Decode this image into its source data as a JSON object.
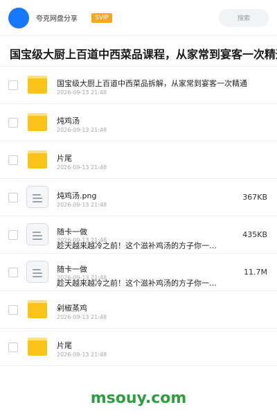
{
  "header": {
    "user_name": "夸克网盘分享",
    "badge": "SVIP",
    "search_placeholder": "搜索",
    "accent": "#1677ff",
    "badge_color": "#f5a623"
  },
  "title": "国宝级大厨上百道中西菜品课程，从家常到宴客一次精通",
  "files": [
    {
      "type": "folder-icon",
      "name": "国宝级大厨上百道中西菜品拆解，从家常到宴客一次精通",
      "date": "2026-09-13 21:48",
      "size": "",
      "desc": ""
    },
    {
      "type": "folder-icon",
      "name": "炖鸡汤",
      "date": "2026-09-13 21:48",
      "size": "",
      "desc": ""
    },
    {
      "type": "folder-icon",
      "name": "片尾",
      "date": "2026-09-13 21:48",
      "size": "",
      "desc": ""
    },
    {
      "type": "document-icon",
      "name": "炖鸡汤.png",
      "date": "2026-09-13 21:48",
      "size": "367KB",
      "desc": ""
    },
    {
      "type": "document-icon",
      "name": "随卡一做",
      "date": "2026-09-13 21:48",
      "size": "435KB",
      "desc": "趁天越来越冷之前！这个滋补鸡汤的方子你一…"
    },
    {
      "type": "document-icon",
      "name": "随卡一做",
      "date": "2026-09-13 21:48",
      "size": "11.7M",
      "desc": "趁天越来越冷之前！这个滋补鸡汤的方子你一…"
    },
    {
      "type": "folder-icon",
      "name": "剁椒蒸鸡",
      "date": "2026-09-13 21:48",
      "size": "",
      "desc": ""
    },
    {
      "type": "folder-icon",
      "name": "片尾",
      "date": "2026-09-13 21:48",
      "size": "",
      "desc": ""
    }
  ],
  "watermark": "msouy.com"
}
